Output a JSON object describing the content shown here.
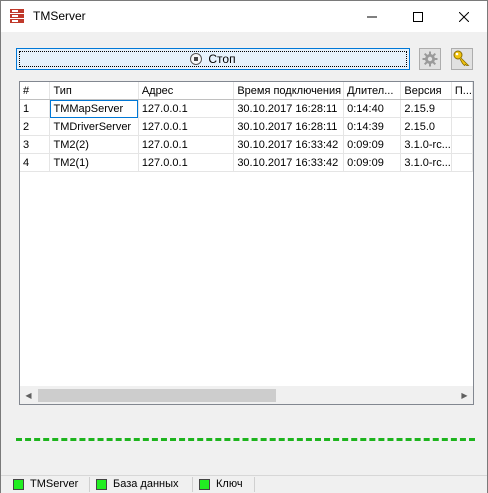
{
  "window": {
    "title": "TMServer"
  },
  "toolbar": {
    "stop_label": "Стоп"
  },
  "table": {
    "columns": [
      "#",
      "Тип",
      "Адрес",
      "Время подключения",
      "Длител...",
      "Версия",
      "П..."
    ],
    "rows": [
      [
        "1",
        "TMMapServer",
        "127.0.0.1",
        "30.10.2017 16:28:11",
        "0:14:40",
        "2.15.9",
        ""
      ],
      [
        "2",
        "TMDriverServer",
        "127.0.0.1",
        "30.10.2017 16:28:11",
        "0:14:39",
        "2.15.0",
        ""
      ],
      [
        "3",
        "TM2(2)",
        "127.0.0.1",
        "30.10.2017 16:33:42",
        "0:09:09",
        "3.1.0-rc...",
        ""
      ],
      [
        "4",
        "TM2(1)",
        "127.0.0.1",
        "30.10.2017 16:33:42",
        "0:09:09",
        "3.1.0-rc...",
        ""
      ]
    ]
  },
  "status": {
    "items": [
      {
        "label": "TMServer",
        "color": "#22ee22"
      },
      {
        "label": "База данных",
        "color": "#22ee22"
      },
      {
        "label": "Ключ",
        "color": "#22ee22"
      }
    ]
  },
  "colors": {
    "accent": "#0078d7",
    "status_ok": "#22ee22",
    "dash_line": "#1db41d"
  },
  "icons": {
    "app": "server-stack-icon",
    "stop": "stop-circle-icon",
    "settings": "gear-icon",
    "key": "key-icon"
  }
}
